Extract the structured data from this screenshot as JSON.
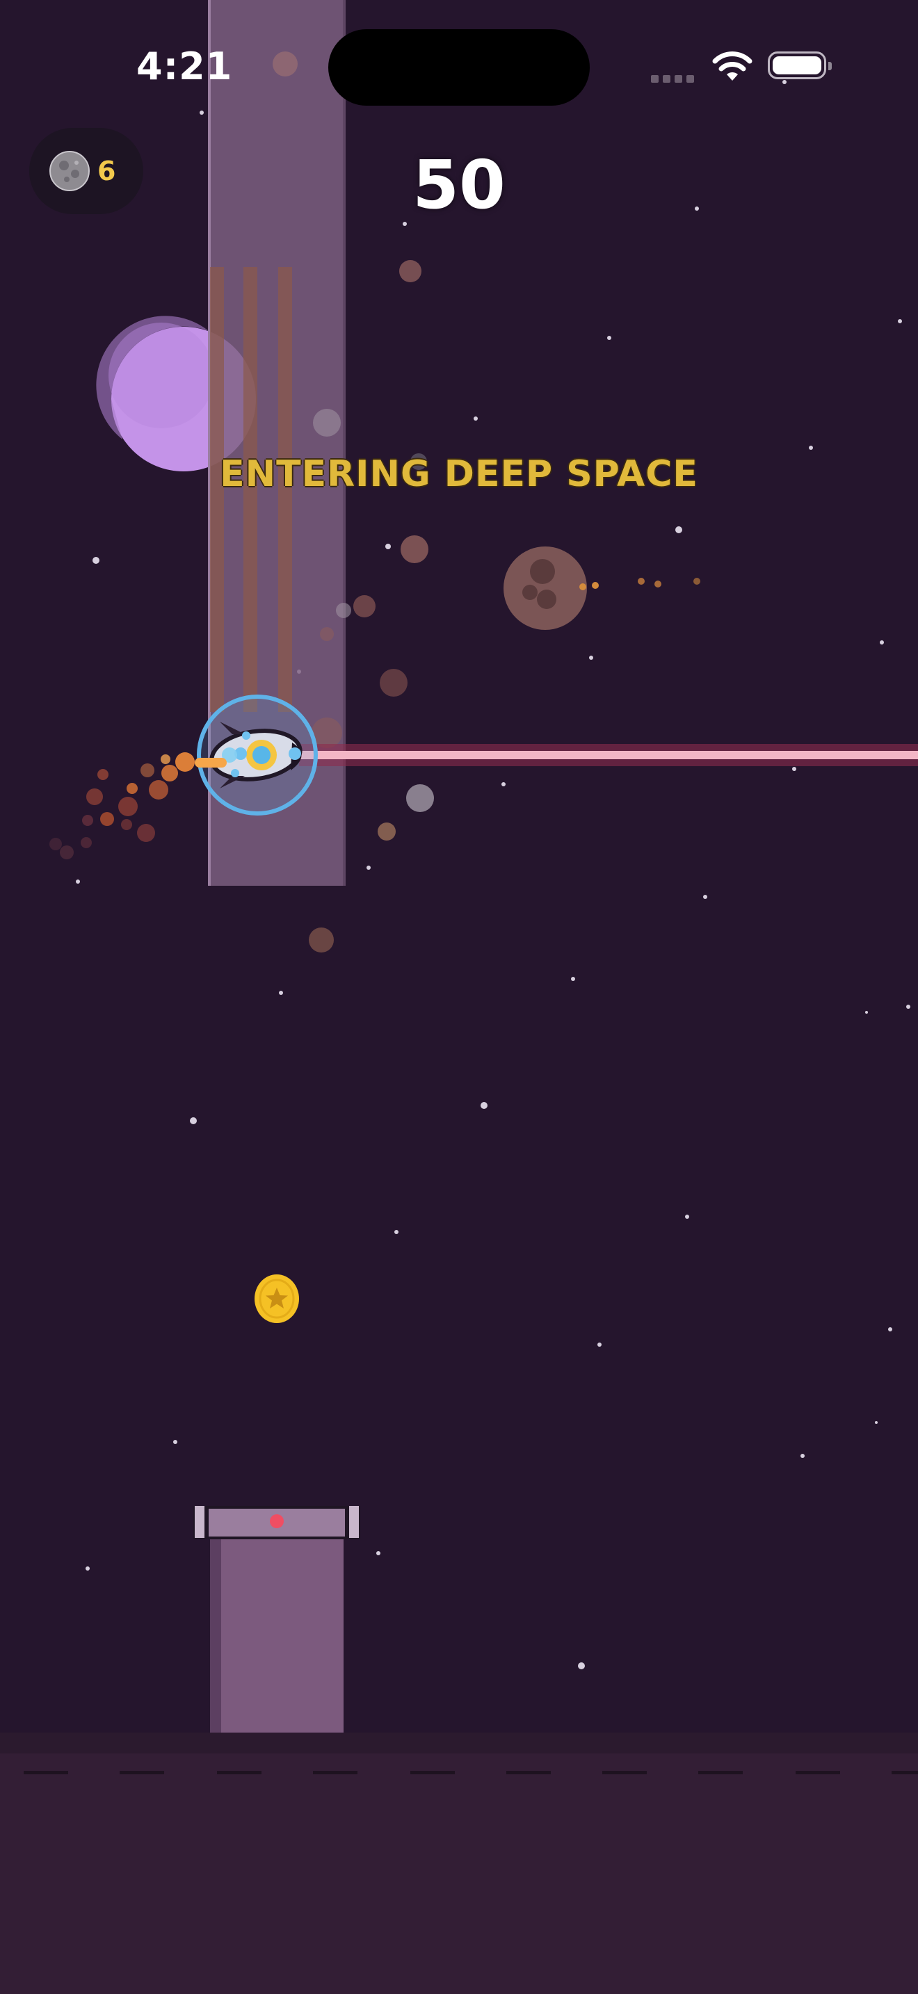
{
  "status_bar": {
    "time": "4:21"
  },
  "hud": {
    "moon_count": "6",
    "score": "50"
  },
  "banner": {
    "text": "ENTERING DEEP SPACE"
  },
  "icons": {
    "wifi": "wifi-icon",
    "battery": "battery-icon",
    "moon": "moon-icon",
    "coin": "star-coin-icon",
    "player": "rocket-ship-icon"
  },
  "colors": {
    "background": "#25152d",
    "pillar": "#7f6283",
    "banner_text": "#e1b93b",
    "moon_count": "#f2c94c",
    "laser": "#f3b6c6",
    "shield": "#5fb2e8",
    "coin": "#f5c125",
    "planet": "#c493e8"
  }
}
